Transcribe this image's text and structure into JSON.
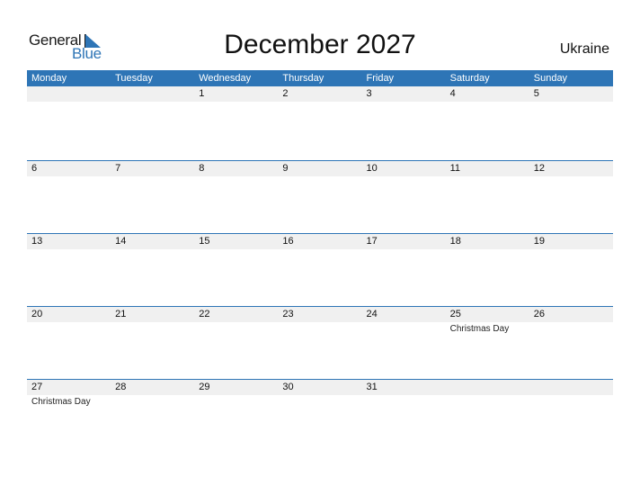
{
  "brand": {
    "general": "General",
    "blue": "Blue"
  },
  "title": "December 2027",
  "country": "Ukraine",
  "colors": {
    "accent": "#2E75B6",
    "date_strip": "#F0F0F0"
  },
  "weekdays": [
    "Monday",
    "Tuesday",
    "Wednesday",
    "Thursday",
    "Friday",
    "Saturday",
    "Sunday"
  ],
  "weeks": [
    [
      {
        "d": ""
      },
      {
        "d": ""
      },
      {
        "d": "1"
      },
      {
        "d": "2"
      },
      {
        "d": "3"
      },
      {
        "d": "4"
      },
      {
        "d": "5"
      }
    ],
    [
      {
        "d": "6"
      },
      {
        "d": "7"
      },
      {
        "d": "8"
      },
      {
        "d": "9"
      },
      {
        "d": "10"
      },
      {
        "d": "11"
      },
      {
        "d": "12"
      }
    ],
    [
      {
        "d": "13"
      },
      {
        "d": "14"
      },
      {
        "d": "15"
      },
      {
        "d": "16"
      },
      {
        "d": "17"
      },
      {
        "d": "18"
      },
      {
        "d": "19"
      }
    ],
    [
      {
        "d": "20"
      },
      {
        "d": "21"
      },
      {
        "d": "22"
      },
      {
        "d": "23"
      },
      {
        "d": "24"
      },
      {
        "d": "25",
        "event": "Christmas Day"
      },
      {
        "d": "26"
      }
    ],
    [
      {
        "d": "27",
        "event": "Christmas Day"
      },
      {
        "d": "28"
      },
      {
        "d": "29"
      },
      {
        "d": "30"
      },
      {
        "d": "31"
      },
      {
        "d": ""
      },
      {
        "d": ""
      }
    ]
  ]
}
